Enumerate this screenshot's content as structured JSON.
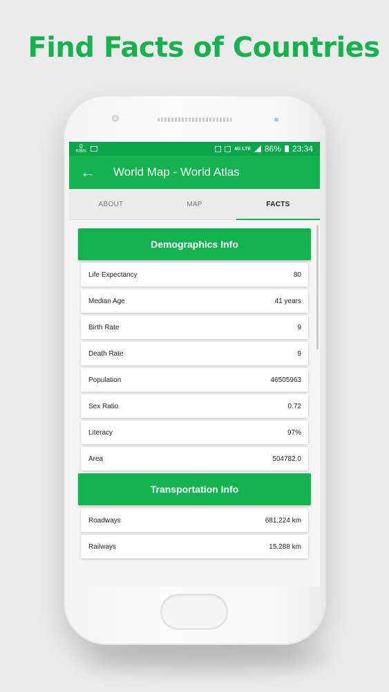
{
  "headline": "Find Facts of Countries",
  "status_bar": {
    "speed_value": "0",
    "speed_unit": "KB/s",
    "lte_label": "4G LTE",
    "battery_percent": "86%",
    "time": "23:34"
  },
  "app_bar": {
    "back_icon": "arrow-back-icon",
    "title": "World Map - World Atlas"
  },
  "tabs": [
    {
      "label": "ABOUT",
      "active": false
    },
    {
      "label": "MAP",
      "active": false
    },
    {
      "label": "FACTS",
      "active": true
    }
  ],
  "demographics": {
    "header": "Demographics Info",
    "rows": [
      {
        "label": "Life Expectancy",
        "value": "80"
      },
      {
        "label": "Median Age",
        "value": "41 years"
      },
      {
        "label": "Birth Rate",
        "value": "9"
      },
      {
        "label": "Death Rate",
        "value": "9"
      },
      {
        "label": "Population",
        "value": "46505963"
      },
      {
        "label": "Sex Ratio",
        "value": "0.72"
      },
      {
        "label": "Literacy",
        "value": "97%"
      },
      {
        "label": "Area",
        "value": "504782.0"
      }
    ]
  },
  "transportation": {
    "header": "Transportation Info",
    "rows": [
      {
        "label": "Roadways",
        "value": "681,224 km"
      },
      {
        "label": "Railways",
        "value": "15,288 km"
      }
    ]
  },
  "colors": {
    "brand_green": "#13b450",
    "status_green": "#0aa74a",
    "headline_green": "#17b24f"
  }
}
